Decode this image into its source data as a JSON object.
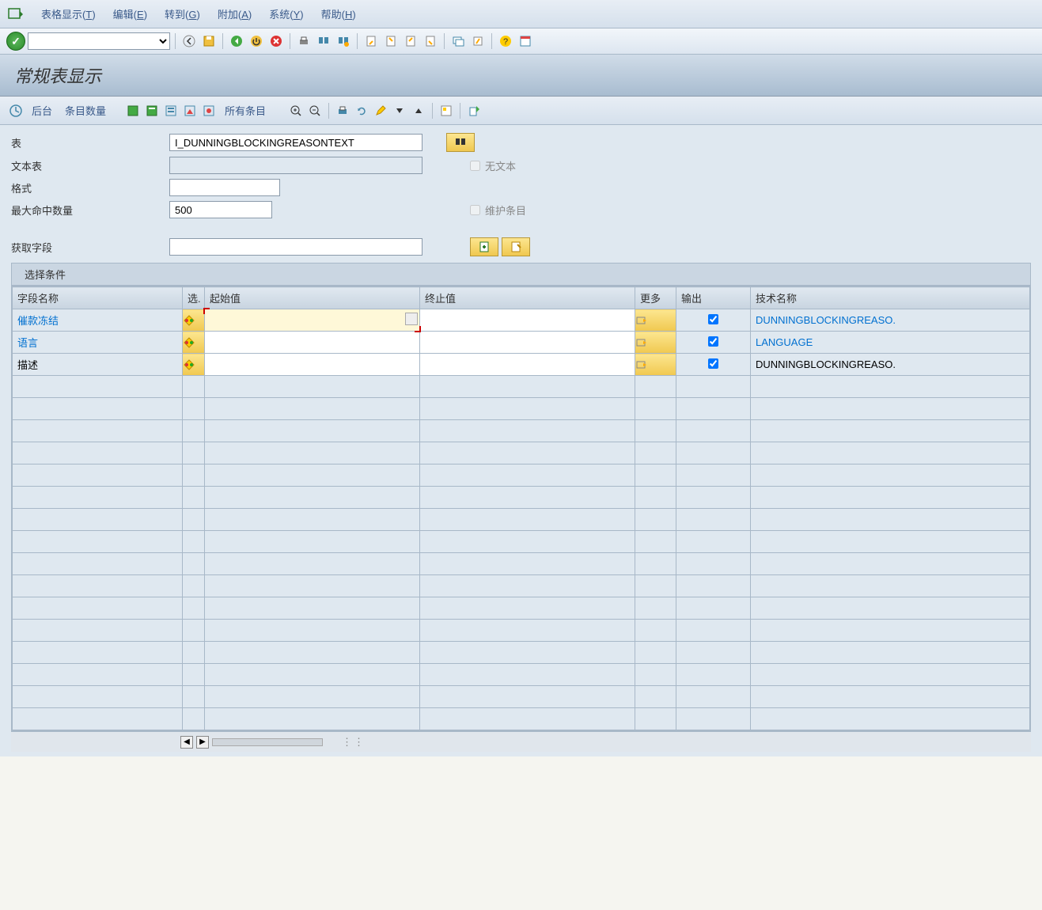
{
  "menu": {
    "items": [
      {
        "label": "表格显示",
        "key": "T"
      },
      {
        "label": "编辑",
        "key": "E"
      },
      {
        "label": "转到",
        "key": "G"
      },
      {
        "label": "附加",
        "key": "A"
      },
      {
        "label": "系统",
        "key": "Y"
      },
      {
        "label": "帮助",
        "key": "H"
      }
    ]
  },
  "title": "常规表显示",
  "app_toolbar": {
    "btn_background": "后台",
    "btn_entries": "条目数量",
    "btn_all_entries": "所有条目"
  },
  "form": {
    "table_label": "表",
    "table_value": "I_DUNNINGBLOCKINGREASONTEXT",
    "text_table_label": "文本表",
    "text_table_value": "",
    "format_label": "格式",
    "format_value": "",
    "max_hits_label": "最大命中数量",
    "max_hits_value": "500",
    "no_text_label": "无文本",
    "maintain_label": "维护条目",
    "get_fields_label": "获取字段",
    "get_fields_value": ""
  },
  "section_title": "选择条件",
  "grid": {
    "headers": {
      "field": "字段名称",
      "sel": "选.",
      "from": "起始值",
      "to": "终止值",
      "more": "更多",
      "out": "输出",
      "tech": "技术名称"
    },
    "rows": [
      {
        "field": "催款冻结",
        "link": true,
        "active": true,
        "from": "",
        "to": "",
        "out": true,
        "tech": "DUNNINGBLOCKINGREASO.",
        "tech_link": true
      },
      {
        "field": "语言",
        "link": true,
        "active": false,
        "from": "",
        "to": "",
        "out": true,
        "tech": "LANGUAGE",
        "tech_link": true
      },
      {
        "field": "描述",
        "link": false,
        "active": false,
        "from": "",
        "to": "",
        "out": true,
        "tech": "DUNNINGBLOCKINGREASO.",
        "tech_link": false
      }
    ],
    "empty_rows": 16
  }
}
